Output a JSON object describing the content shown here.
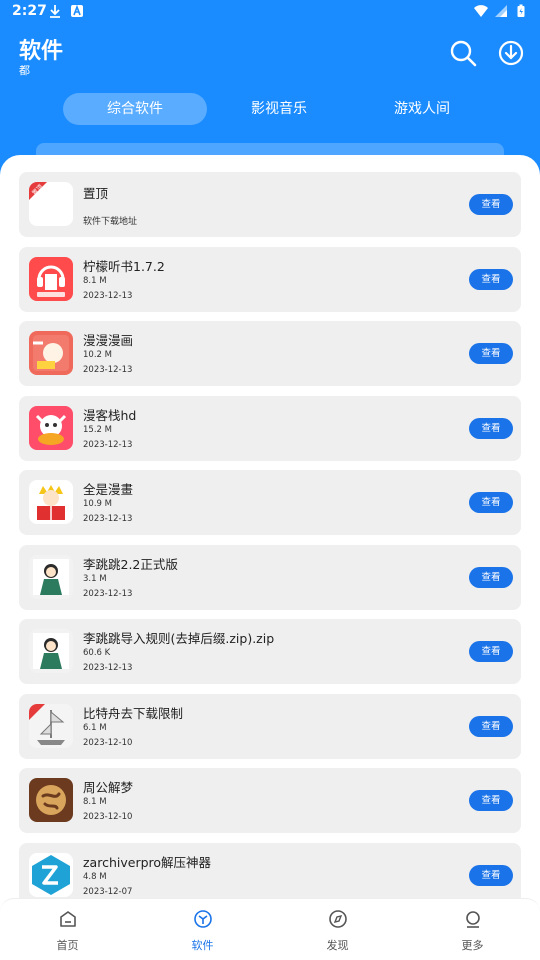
{
  "status": {
    "time": "2:27"
  },
  "header": {
    "title": "软件",
    "subtitle": "都",
    "search_icon": "search-icon",
    "download_icon": "download-icon"
  },
  "tabs": [
    {
      "label": "综合软件"
    },
    {
      "label": "影视音乐"
    },
    {
      "label": "游戏人间"
    }
  ],
  "items": [
    {
      "name": "置顶",
      "subtext": "软件下载地址",
      "badge": "置顶",
      "button": "查看"
    },
    {
      "name": "柠檬听书1.7.2",
      "size": "8.1 M",
      "date": "2023-12-13",
      "button": "查看"
    },
    {
      "name": " 漫漫漫画",
      "size": "10.2 M",
      "date": "2023-12-13",
      "button": "查看"
    },
    {
      "name": " 漫客栈hd",
      "size": "15.2 M",
      "date": "2023-12-13",
      "button": "查看"
    },
    {
      "name": " 全是漫畫",
      "size": "10.9 M",
      "date": "2023-12-13",
      "button": "查看"
    },
    {
      "name": "李跳跳2.2正式版",
      "size": "3.1 M",
      "date": "2023-12-13",
      "button": "查看"
    },
    {
      "name": " 李跳跳导入规则(去掉后缀.zip).zip",
      "size": "60.6 K",
      "date": "2023-12-13",
      "button": "查看"
    },
    {
      "name": "比特舟去下载限制",
      "size": "6.1 M",
      "date": "2023-12-10",
      "button": "查看"
    },
    {
      "name": "周公解梦",
      "size": "8.1 M",
      "date": "2023-12-10",
      "button": "查看"
    },
    {
      "name": "zarchiverpro解压神器",
      "size": "4.8 M",
      "date": "2023-12-07",
      "button": "查看"
    }
  ],
  "bottom_nav": [
    {
      "label": "首页",
      "icon": "home-icon"
    },
    {
      "label": "软件",
      "icon": "software-icon",
      "active": true
    },
    {
      "label": "发现",
      "icon": "compass-icon"
    },
    {
      "label": "更多",
      "icon": "more-icon"
    }
  ],
  "colors": {
    "accent": "#1a8cff",
    "button": "#1a73e8",
    "card_bg": "#efefef"
  }
}
